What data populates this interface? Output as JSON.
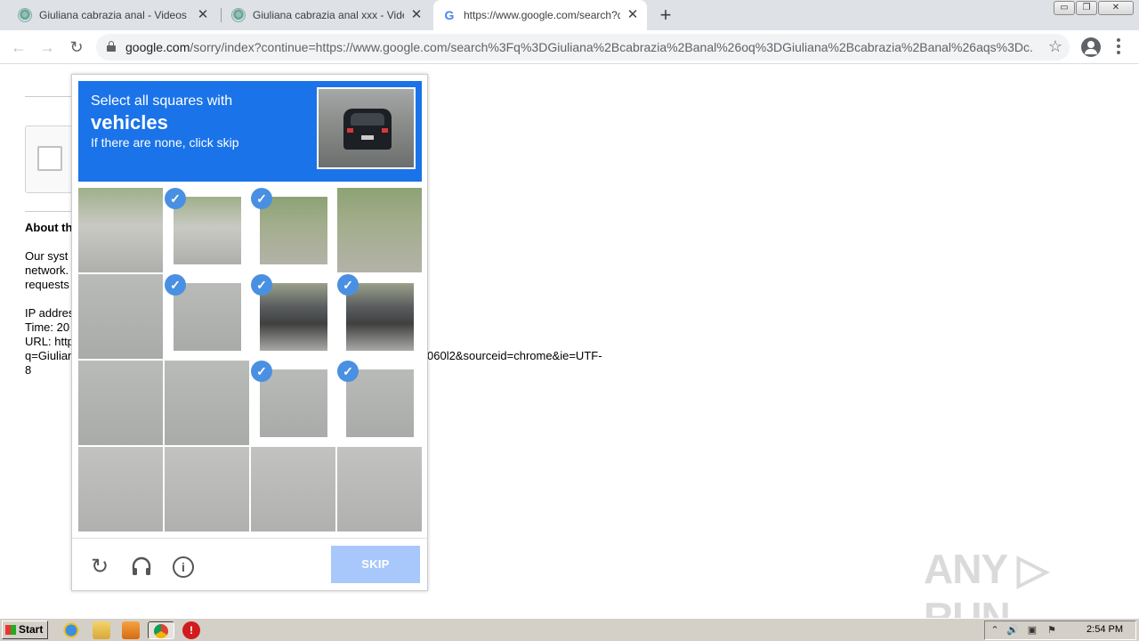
{
  "browser": {
    "tabs": [
      {
        "title": "Giuliana cabrazia anal - Videos Xxx P",
        "close": "✕"
      },
      {
        "title": "Giuliana cabrazia anal xxx - Videos X",
        "close": "✕"
      },
      {
        "title": "https://www.google.com/search?q=",
        "close": "✕"
      }
    ],
    "new_tab": "+",
    "window_controls": {
      "minimize": "▭",
      "restore": "❐",
      "close": "✕"
    },
    "nav": {
      "back": "←",
      "forward": "→",
      "reload": "↻"
    },
    "address": {
      "host": "google.com",
      "path": "/sorry/index?continue=https://www.google.com/search%3Fq%3DGiuliana%2Bcabrazia%2Banal%26oq%3DGiuliana%2Bcabrazia%2Banal%26aqs%3Dc..."
    },
    "bookmark": "☆"
  },
  "page": {
    "about_title": "About th",
    "body_lines": [
      "Our syst",
      "network.",
      "requests"
    ],
    "ip_lines": [
      "IP addres",
      "Time: 20",
      "URL: http",
      "q=Giulian",
      "8"
    ],
    "url_tail": "060l2&sourceid=chrome&ie=UTF-"
  },
  "captcha": {
    "instruction": "Select all squares with",
    "target": "vehicles",
    "hint": "If there are none, click skip",
    "skip_label": "SKIP",
    "check_glyph": "✓",
    "tiles": [
      {
        "kind": "street",
        "selected": false
      },
      {
        "kind": "street",
        "selected": true
      },
      {
        "kind": "trees",
        "selected": true
      },
      {
        "kind": "trees",
        "selected": false
      },
      {
        "kind": "road",
        "selected": false
      },
      {
        "kind": "road",
        "selected": true
      },
      {
        "kind": "cars",
        "selected": true
      },
      {
        "kind": "cars",
        "selected": true
      },
      {
        "kind": "road",
        "selected": false
      },
      {
        "kind": "road",
        "selected": false
      },
      {
        "kind": "road",
        "selected": true
      },
      {
        "kind": "road",
        "selected": true
      },
      {
        "kind": "road2",
        "selected": false
      },
      {
        "kind": "road2",
        "selected": false
      },
      {
        "kind": "road2",
        "selected": false
      },
      {
        "kind": "road2",
        "selected": false
      }
    ],
    "icons": {
      "reload": "reload-icon",
      "audio": "headphones-icon",
      "info": "info-icon"
    }
  },
  "watermark": "ANY ▷ RUN",
  "taskbar": {
    "start_label": "Start",
    "clock": "2:54 PM"
  },
  "colors": {
    "captcha_header": "#1a73e8",
    "skip_button": "#a8c7fa",
    "check": "#4a90e2"
  }
}
